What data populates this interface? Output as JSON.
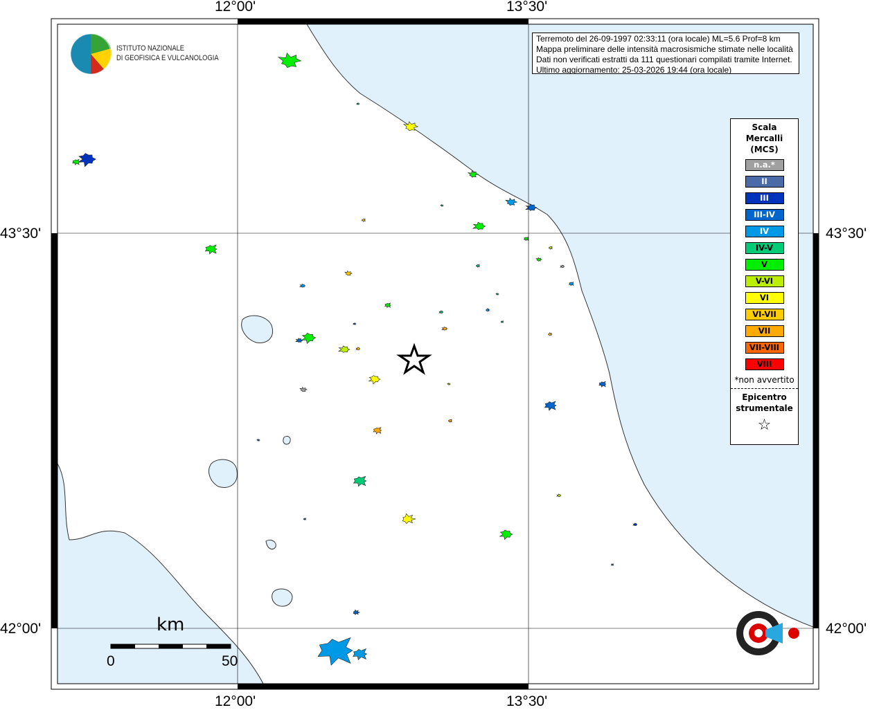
{
  "ticks": {
    "lon_left": "12°00'",
    "lon_right": "13°30'",
    "lat_top": "43°30'",
    "lat_bottom": "42°00'"
  },
  "info": {
    "line1": "Terremoto del 26-09-1997 02:33:11 (ora locale) ML=5.6 Prof=8 km",
    "line2": "Mappa preliminare delle intensità macrosismiche stimate nelle località",
    "line3": "Dati non verificati estratti da 111 questionari compilati tramite Internet.",
    "line4": "Ultimo aggiornamento: 25-03-2026 19:44 (ora locale)"
  },
  "logo": {
    "line1": "ISTITUTO NAZIONALE",
    "line2": "DI GEOFISICA E VULCANOLOGIA",
    "hsit": "www.haisentitoilterremoto.it"
  },
  "legend": {
    "title1": "Scala",
    "title2": "Mercalli",
    "title3": "(MCS)",
    "items": [
      {
        "label": "n.a.*",
        "color": "#a0a0a0",
        "text": "#fff"
      },
      {
        "label": "II",
        "color": "#4a6aa8",
        "text": "#fff"
      },
      {
        "label": "III",
        "color": "#0033bb",
        "text": "#fff"
      },
      {
        "label": "III-IV",
        "color": "#0066cc",
        "text": "#fff"
      },
      {
        "label": "IV",
        "color": "#0099e6",
        "text": "#fff"
      },
      {
        "label": "IV-V",
        "color": "#00cc77",
        "text": "#000"
      },
      {
        "label": "V",
        "color": "#00ee00",
        "text": "#000"
      },
      {
        "label": "V-VI",
        "color": "#bbee00",
        "text": "#000"
      },
      {
        "label": "VI",
        "color": "#ffff00",
        "text": "#000"
      },
      {
        "label": "VI-VII",
        "color": "#ffcc00",
        "text": "#000"
      },
      {
        "label": "VII",
        "color": "#ffaa00",
        "text": "#000"
      },
      {
        "label": "VII-VIII",
        "color": "#ff6600",
        "text": "#000"
      },
      {
        "label": "VIII",
        "color": "#ff0000",
        "text": "#000"
      }
    ],
    "note": "*non avvertito",
    "epi1": "Epicentro",
    "epi2": "strumentale",
    "star": "☆"
  },
  "scalebar": {
    "unit": "km",
    "min": "0",
    "max": "50"
  },
  "colors": {
    "sea": "#e1f1fc"
  }
}
